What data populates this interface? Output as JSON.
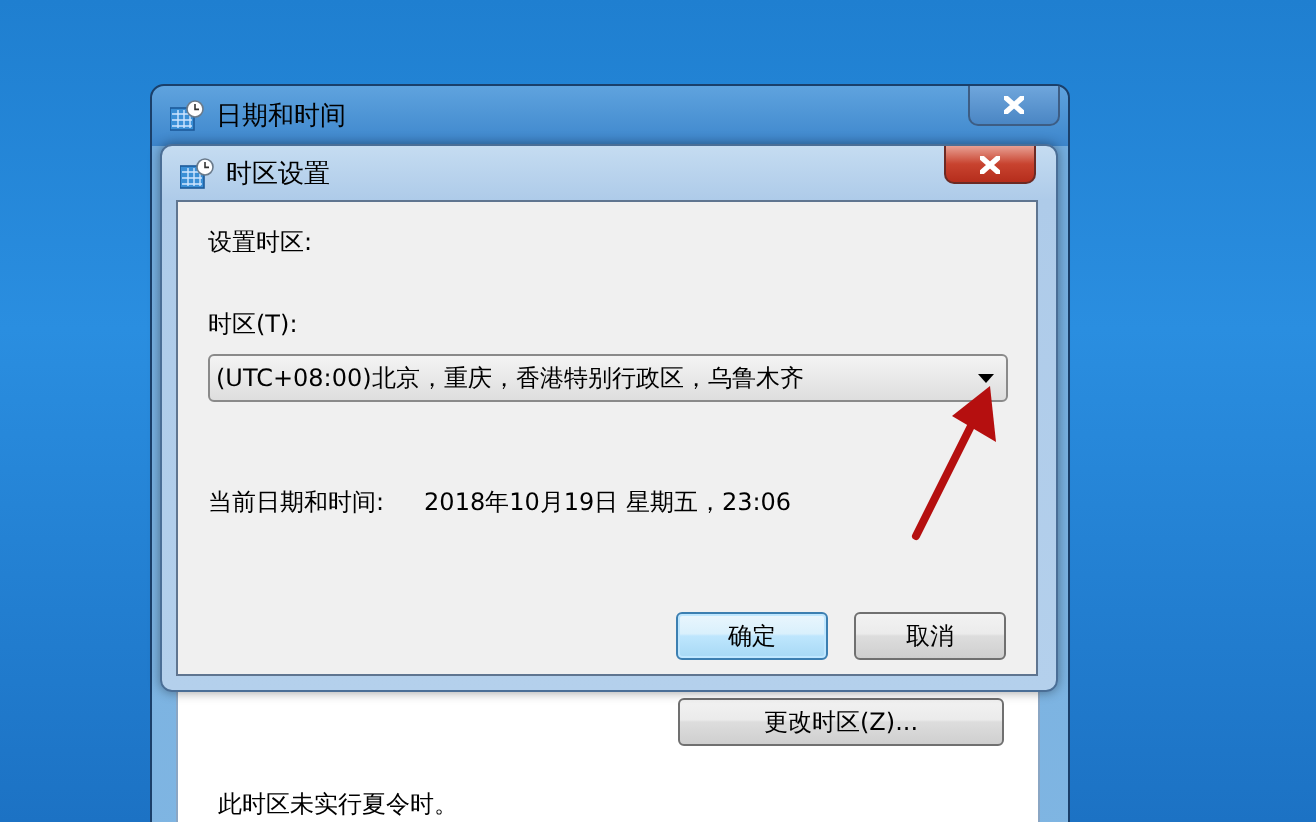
{
  "main_window": {
    "title": "日期和时间",
    "change_timezone_button": "更改时区(Z)...",
    "dst_note": "此时区未实行夏令时。"
  },
  "timezone_dialog": {
    "title": "时区设置",
    "heading": "设置时区:",
    "timezone_label": "时区(T):",
    "timezone_select": {
      "value": "(UTC+08:00)北京，重庆，香港特别行政区，乌鲁木齐"
    },
    "current_time_label": "当前日期和时间:",
    "current_time_value": "2018年10月19日 星期五，23:06",
    "buttons": [
      {
        "label": "确定",
        "default": true
      },
      {
        "label": "取消",
        "default": false
      }
    ]
  }
}
